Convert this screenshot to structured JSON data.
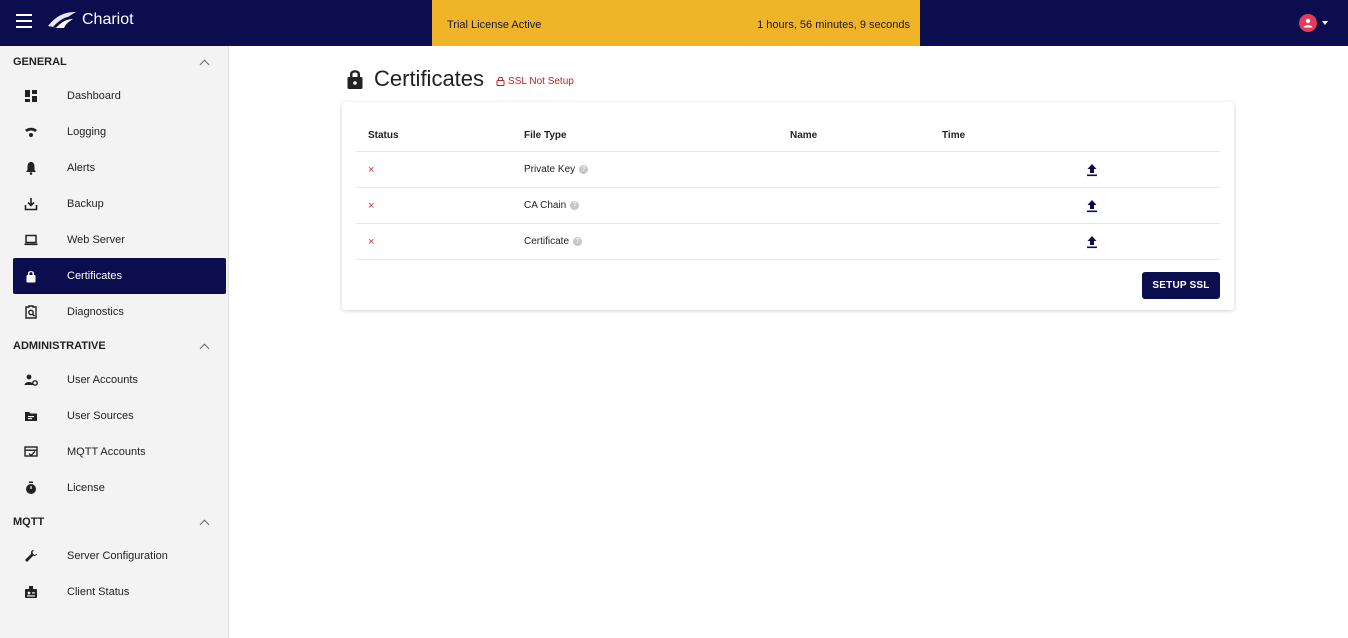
{
  "app": {
    "name": "Chariot"
  },
  "license": {
    "label": "Trial License Active",
    "timer": "1 hours, 56 minutes, 9 seconds"
  },
  "colors": {
    "topbar": "#0b0d4f",
    "banner": "#f0b429",
    "avatar": "#e63a5a",
    "active": "#0b0d4f",
    "error": "#c0392b"
  },
  "sidebar": {
    "sections": [
      {
        "title": "GENERAL",
        "items": [
          {
            "label": "Dashboard",
            "icon": "dashboard-icon"
          },
          {
            "label": "Logging",
            "icon": "wifi-icon"
          },
          {
            "label": "Alerts",
            "icon": "bell-icon"
          },
          {
            "label": "Backup",
            "icon": "download-icon"
          },
          {
            "label": "Web Server",
            "icon": "laptop-icon"
          },
          {
            "label": "Certificates",
            "icon": "lock-icon",
            "active": true
          },
          {
            "label": "Diagnostics",
            "icon": "clipboard-search-icon"
          }
        ]
      },
      {
        "title": "ADMINISTRATIVE",
        "items": [
          {
            "label": "User Accounts",
            "icon": "user-gear-icon"
          },
          {
            "label": "User Sources",
            "icon": "folder-icon"
          },
          {
            "label": "MQTT Accounts",
            "icon": "card-check-icon"
          },
          {
            "label": "License",
            "icon": "stopwatch-icon"
          }
        ]
      },
      {
        "title": "MQTT",
        "items": [
          {
            "label": "Server Configuration",
            "icon": "wrench-icon"
          },
          {
            "label": "Client Status",
            "icon": "badge-icon"
          }
        ]
      }
    ]
  },
  "page": {
    "title": "Certificates",
    "ssl_status": "SSL Not Setup"
  },
  "table": {
    "headers": {
      "status": "Status",
      "type": "File Type",
      "name": "Name",
      "time": "Time"
    },
    "rows": [
      {
        "status": "×",
        "type": "Private Key",
        "name": "",
        "time": ""
      },
      {
        "status": "×",
        "type": "CA Chain",
        "name": "",
        "time": ""
      },
      {
        "status": "×",
        "type": "Certificate",
        "name": "",
        "time": ""
      }
    ]
  },
  "actions": {
    "setup_ssl": "SETUP SSL"
  }
}
